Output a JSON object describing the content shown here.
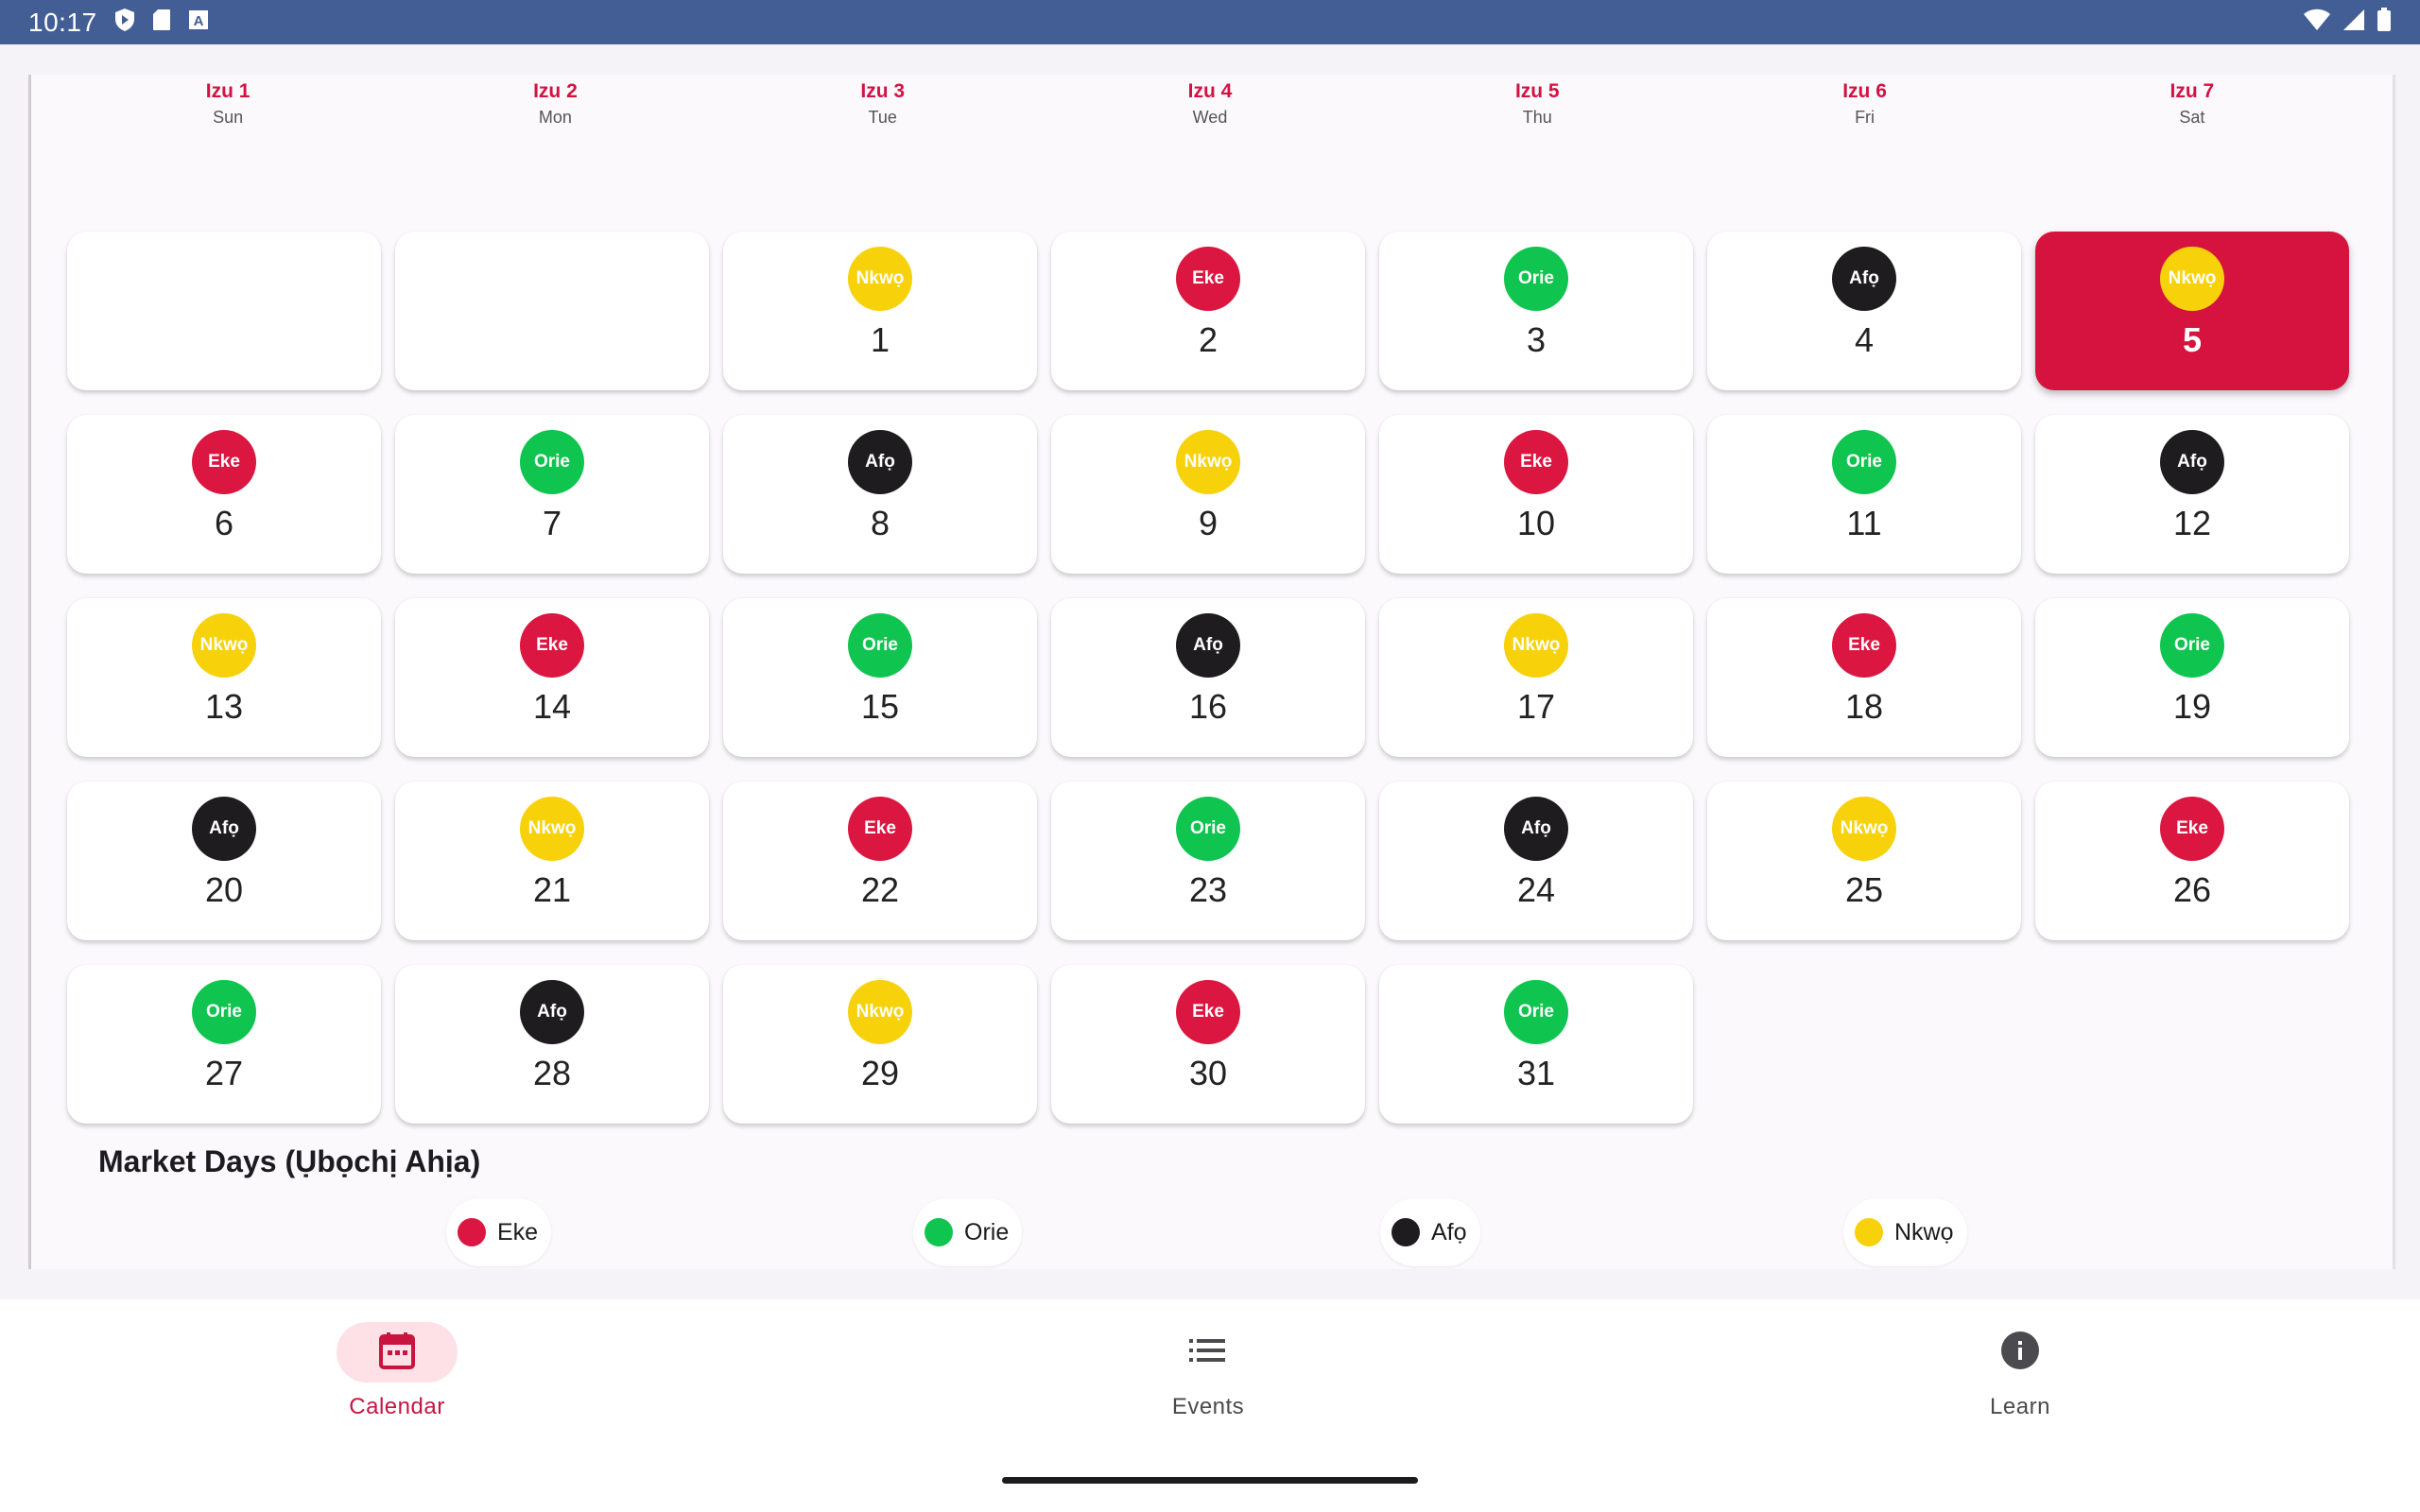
{
  "status_bar": {
    "time": "10:17",
    "icons_left": [
      "play-protect-icon",
      "sd-card-icon",
      "text-a-icon"
    ],
    "icons_right": [
      "wifi-icon",
      "signal-icon",
      "battery-icon"
    ]
  },
  "week_header": [
    {
      "izu": "Izu 1",
      "day": "Sun"
    },
    {
      "izu": "Izu 2",
      "day": "Mon"
    },
    {
      "izu": "Izu 3",
      "day": "Tue"
    },
    {
      "izu": "Izu 4",
      "day": "Wed"
    },
    {
      "izu": "Izu 5",
      "day": "Thu"
    },
    {
      "izu": "Izu 6",
      "day": "Fri"
    },
    {
      "izu": "Izu 7",
      "day": "Sat"
    }
  ],
  "calendar": {
    "leading_empty_cells": 2,
    "today": 5,
    "days": [
      {
        "day": "1",
        "market": "Nkwọ",
        "type": "nkwo"
      },
      {
        "day": "2",
        "market": "Eke",
        "type": "eke"
      },
      {
        "day": "3",
        "market": "Orie",
        "type": "orie"
      },
      {
        "day": "4",
        "market": "Afọ",
        "type": "afo"
      },
      {
        "day": "5",
        "market": "Nkwọ",
        "type": "nkwo"
      },
      {
        "day": "6",
        "market": "Eke",
        "type": "eke"
      },
      {
        "day": "7",
        "market": "Orie",
        "type": "orie"
      },
      {
        "day": "8",
        "market": "Afọ",
        "type": "afo"
      },
      {
        "day": "9",
        "market": "Nkwọ",
        "type": "nkwo"
      },
      {
        "day": "10",
        "market": "Eke",
        "type": "eke"
      },
      {
        "day": "11",
        "market": "Orie",
        "type": "orie"
      },
      {
        "day": "12",
        "market": "Afọ",
        "type": "afo"
      },
      {
        "day": "13",
        "market": "Nkwọ",
        "type": "nkwo"
      },
      {
        "day": "14",
        "market": "Eke",
        "type": "eke"
      },
      {
        "day": "15",
        "market": "Orie",
        "type": "orie"
      },
      {
        "day": "16",
        "market": "Afọ",
        "type": "afo"
      },
      {
        "day": "17",
        "market": "Nkwọ",
        "type": "nkwo"
      },
      {
        "day": "18",
        "market": "Eke",
        "type": "eke"
      },
      {
        "day": "19",
        "market": "Orie",
        "type": "orie"
      },
      {
        "day": "20",
        "market": "Afọ",
        "type": "afo"
      },
      {
        "day": "21",
        "market": "Nkwọ",
        "type": "nkwo"
      },
      {
        "day": "22",
        "market": "Eke",
        "type": "eke"
      },
      {
        "day": "23",
        "market": "Orie",
        "type": "orie"
      },
      {
        "day": "24",
        "market": "Afọ",
        "type": "afo"
      },
      {
        "day": "25",
        "market": "Nkwọ",
        "type": "nkwo"
      },
      {
        "day": "26",
        "market": "Eke",
        "type": "eke"
      },
      {
        "day": "27",
        "market": "Orie",
        "type": "orie"
      },
      {
        "day": "28",
        "market": "Afọ",
        "type": "afo"
      },
      {
        "day": "29",
        "market": "Nkwọ",
        "type": "nkwo"
      },
      {
        "day": "30",
        "market": "Eke",
        "type": "eke"
      },
      {
        "day": "31",
        "market": "Orie",
        "type": "orie"
      }
    ]
  },
  "legend": {
    "title": "Market Days (Ụbọchị Ahịa)",
    "items": [
      {
        "label": "Eke",
        "color": "#db1640"
      },
      {
        "label": "Orie",
        "color": "#0fc44f"
      },
      {
        "label": "Afọ",
        "color": "#1f1c1f"
      },
      {
        "label": "Nkwọ",
        "color": "#f7d10a"
      }
    ]
  },
  "colors": {
    "accent": "#d6123e",
    "status_bar": "#435e95",
    "eke": "#db1640",
    "orie": "#0fc44f",
    "afo": "#1f1c1f",
    "nkwo": "#f7d10a"
  },
  "bottom_nav": {
    "items": [
      {
        "label": "Calendar",
        "icon": "calendar-icon",
        "active": true
      },
      {
        "label": "Events",
        "icon": "list-icon",
        "active": false
      },
      {
        "label": "Learn",
        "icon": "info-icon",
        "active": false
      }
    ]
  }
}
